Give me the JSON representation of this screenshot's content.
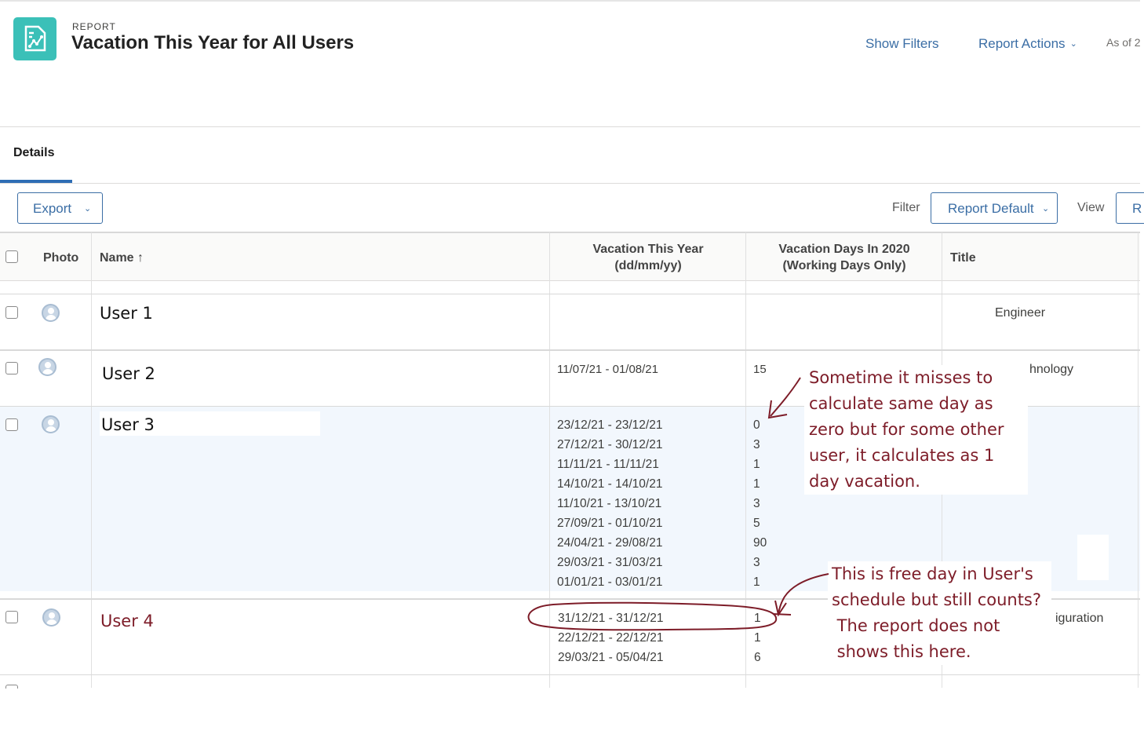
{
  "header": {
    "kicker": "REPORT",
    "title": "Vacation This Year for All Users",
    "show_filters": "Show Filters",
    "report_actions": "Report Actions",
    "as_of": "As of 2",
    "icon": "report-chart-icon"
  },
  "tabs": [
    {
      "label": "Details",
      "active": true
    }
  ],
  "toolbar": {
    "export": "Export",
    "filter_label": "Filter",
    "filter_value": "Report Default",
    "view_label": "View",
    "view_value": "R"
  },
  "table": {
    "columns": {
      "photo": "Photo",
      "name": "Name ↑",
      "vacation_line1": "Vacation This Year",
      "vacation_line2": "(dd/mm/yy)",
      "days_line1": "Vacation Days In 2020",
      "days_line2": "(Working Days Only)",
      "title": "Title"
    },
    "rows": [
      {
        "name": "User 1",
        "title": "Engineer",
        "ranges": [],
        "days": []
      },
      {
        "name": "User 2",
        "title": "hnology",
        "ranges": [
          "11/07/21 - 01/08/21"
        ],
        "days": [
          "15"
        ]
      },
      {
        "name": "User 3",
        "title": "",
        "ranges": [
          "23/12/21 - 23/12/21",
          "27/12/21 - 30/12/21",
          "11/11/21 - 11/11/21",
          "14/10/21 - 14/10/21",
          "11/10/21 - 13/10/21",
          "27/09/21 - 01/10/21",
          "24/04/21 - 29/08/21",
          "29/03/21 - 31/03/21",
          "01/01/21 - 03/01/21"
        ],
        "days": [
          "0",
          "3",
          "1",
          "1",
          "3",
          "5",
          "90",
          "3",
          "1"
        ]
      },
      {
        "name": "User 4",
        "title": "iguration",
        "ranges": [
          "31/12/21 - 31/12/21",
          "22/12/21 - 22/12/21",
          "29/03/21 - 05/04/21"
        ],
        "days": [
          "1",
          "1",
          "6"
        ]
      }
    ]
  },
  "annotations": {
    "note1": [
      "Sometime it misses to",
      "calculate same day as",
      "zero but for some other",
      "user, it calculates as 1",
      "day vacation."
    ],
    "note2": [
      "This is free day in User's",
      "schedule but still counts?",
      " The report does not",
      " shows this here."
    ],
    "color": "#7d1c28"
  },
  "colors": {
    "accent": "#3b6ea5",
    "icon_bg": "#3bc0b8",
    "tab_underline": "#2e6db4",
    "row_highlight": "#f2f7fd"
  }
}
